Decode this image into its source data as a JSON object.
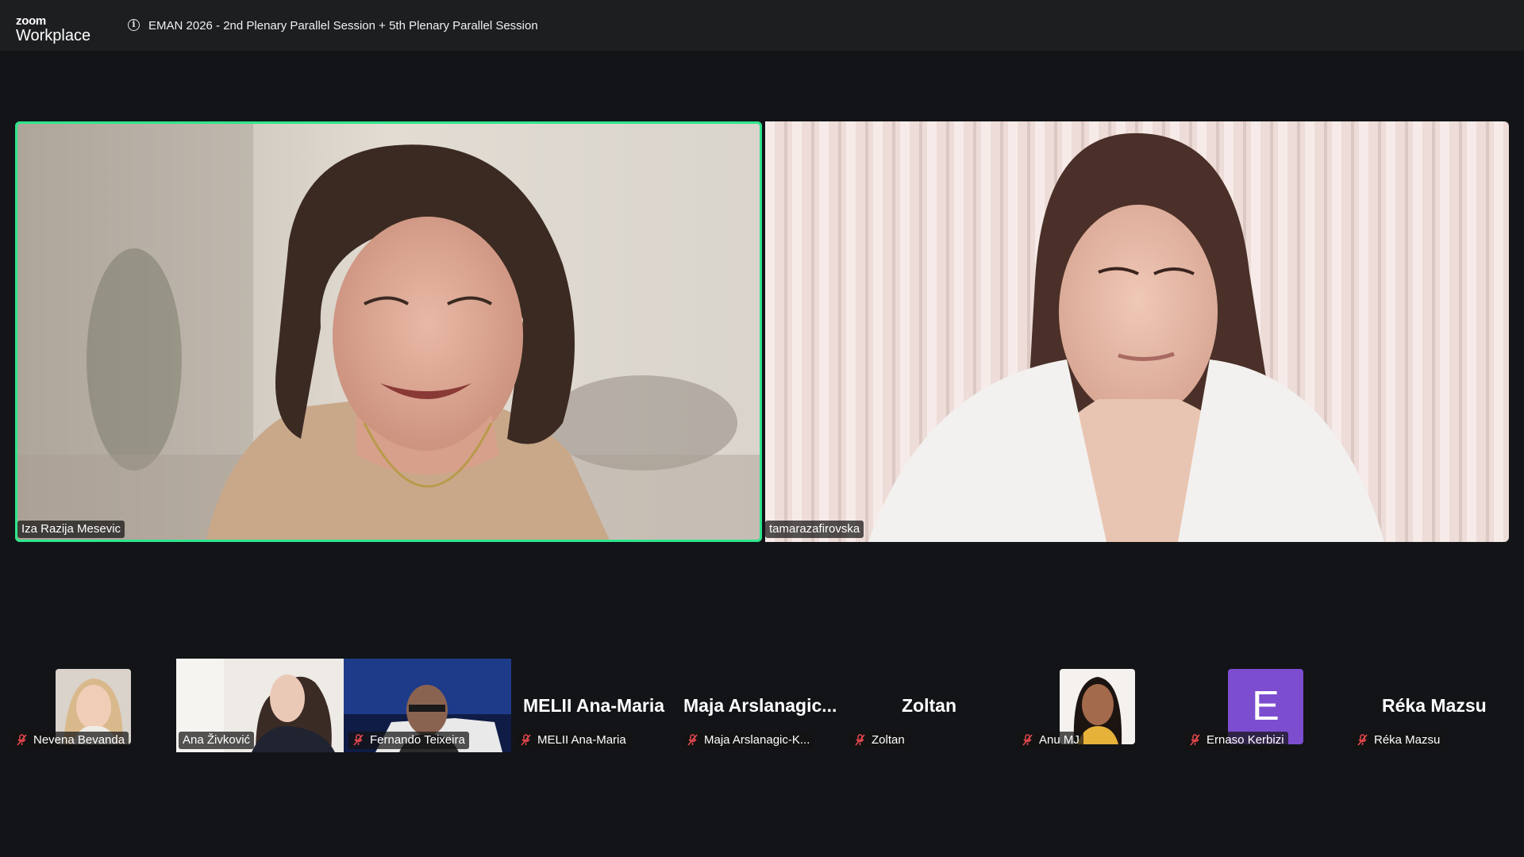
{
  "app": {
    "logo_top": "zoom",
    "logo_bottom": "Workplace"
  },
  "meeting": {
    "title": "EMAN 2026 - 2nd Plenary Parallel Session + 5th Plenary Parallel Session"
  },
  "speakers": [
    {
      "name": "Iza Razija Mesevic",
      "active": true
    },
    {
      "name": "tamarazafirovska",
      "active": false
    }
  ],
  "strip": [
    {
      "name": "Nevena Bevanda",
      "muted": true,
      "display": "photo"
    },
    {
      "name": "Ana Živković",
      "muted": false,
      "display": "video"
    },
    {
      "name": "Fernando Teixeira",
      "muted": true,
      "display": "video"
    },
    {
      "name": "MELII Ana-Maria",
      "muted": true,
      "display": "text",
      "big_label": "MELII Ana-Maria"
    },
    {
      "name": "Maja Arslanagic-K...",
      "muted": true,
      "display": "text",
      "big_label": "Maja  Arslanagic..."
    },
    {
      "name": "Zoltan",
      "muted": true,
      "display": "text",
      "big_label": "Zoltan"
    },
    {
      "name": "Anu MJ",
      "muted": true,
      "display": "photo"
    },
    {
      "name": "Ernaso Kerbizi",
      "muted": true,
      "display": "letter",
      "letter": "E"
    },
    {
      "name": "Réka Mazsu",
      "muted": true,
      "display": "text",
      "big_label": "Réka Mazsu"
    }
  ],
  "colors": {
    "active_speaker_border": "#2ee58c",
    "muted_icon": "#e5484d",
    "letter_avatar": "#7c4dcf"
  }
}
